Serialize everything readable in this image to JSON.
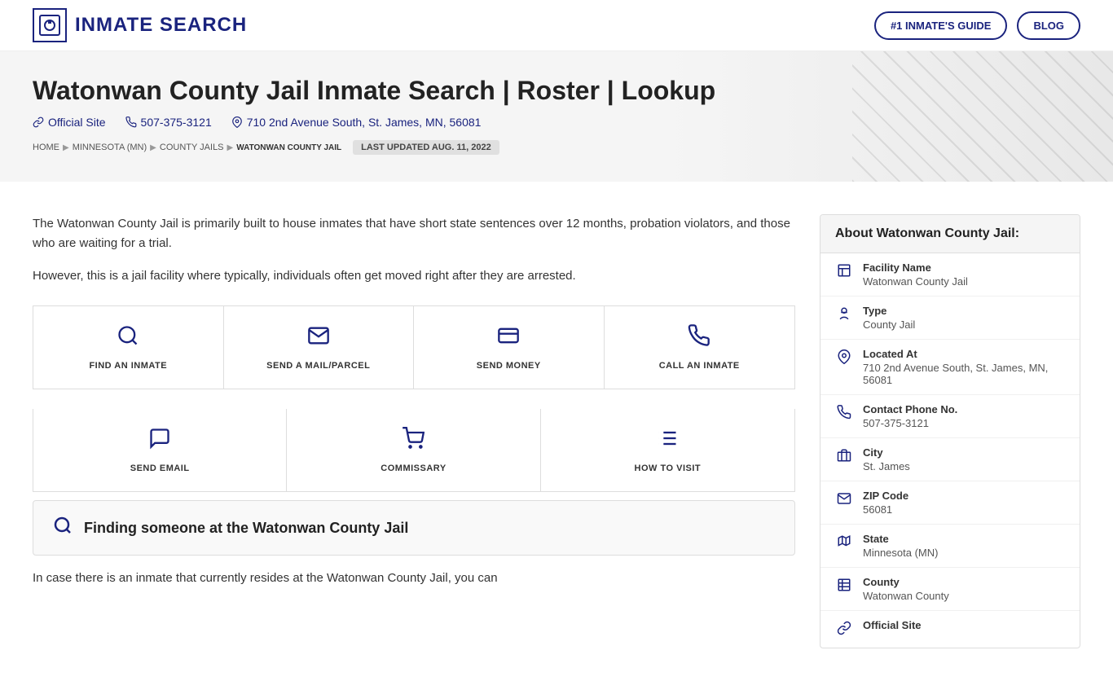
{
  "header": {
    "logo_text": "INMATE SEARCH",
    "nav_btn_guide": "#1 INMATE'S GUIDE",
    "nav_btn_blog": "BLOG"
  },
  "hero": {
    "title": "Watonwan County Jail Inmate Search | Roster | Lookup",
    "official_site_label": "Official Site",
    "phone": "507-375-3121",
    "address": "710 2nd Avenue South, St. James, MN, 56081",
    "breadcrumb": {
      "home": "HOME",
      "state": "MINNESOTA (MN)",
      "category": "COUNTY JAILS",
      "current": "WATONWAN COUNTY JAIL"
    },
    "last_updated": "LAST UPDATED AUG. 11, 2022"
  },
  "description": {
    "para1": "The Watonwan County Jail is primarily built to house inmates that have short state sentences over 12 months, probation violators, and those who are waiting for a trial.",
    "para2": "However, this is a jail facility where typically, individuals often get moved right after they are arrested."
  },
  "actions": {
    "top": [
      {
        "icon": "🔍",
        "label": "FIND AN INMATE"
      },
      {
        "icon": "✉",
        "label": "SEND A MAIL/PARCEL"
      },
      {
        "icon": "💵",
        "label": "SEND MONEY"
      },
      {
        "icon": "📞",
        "label": "CALL AN INMATE"
      }
    ],
    "bottom": [
      {
        "icon": "💬",
        "label": "SEND EMAIL"
      },
      {
        "icon": "🛒",
        "label": "COMMISSARY"
      },
      {
        "icon": "📋",
        "label": "HOW TO VISIT"
      }
    ]
  },
  "find_section": {
    "heading": "Finding someone at the Watonwan County Jail",
    "description": "In case there is an inmate that currently resides at the Watonwan County Jail, you can"
  },
  "sidebar": {
    "title": "About Watonwan County Jail:",
    "items": [
      {
        "icon": "🏢",
        "label": "Facility Name",
        "value": "Watonwan County Jail"
      },
      {
        "icon": "🔑",
        "label": "Type",
        "value": "County Jail"
      },
      {
        "icon": "📍",
        "label": "Located At",
        "value": "710 2nd Avenue South, St. James, MN, 56081"
      },
      {
        "icon": "📞",
        "label": "Contact Phone No.",
        "value": "507-375-3121"
      },
      {
        "icon": "🏙",
        "label": "City",
        "value": "St. James"
      },
      {
        "icon": "✉",
        "label": "ZIP Code",
        "value": "56081"
      },
      {
        "icon": "🗺",
        "label": "State",
        "value": "Minnesota (MN)"
      },
      {
        "icon": "📄",
        "label": "County",
        "value": "Watonwan County"
      },
      {
        "icon": "🔗",
        "label": "Official Site",
        "value": ""
      }
    ]
  }
}
